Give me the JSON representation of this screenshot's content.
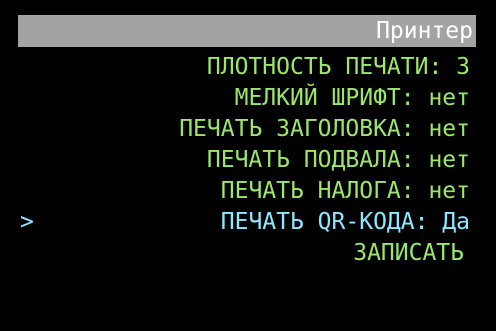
{
  "title": "Принтер",
  "cursor_symbol": ">",
  "colors": {
    "background": "#000000",
    "title_bar": "#a3a3a3",
    "title_text": "#ffffff",
    "item_normal": "#9be76b",
    "item_selected": "#8de8ff"
  },
  "menu": [
    {
      "label": "ПЛОТНОСТЬ ПЕЧАТИ",
      "value": "3",
      "display": "ПЛОТНОСТЬ ПЕЧАТИ: 3",
      "selected": false
    },
    {
      "label": "МЕЛКИЙ ШРИФТ",
      "value": "нет",
      "display": "МЕЛКИЙ ШРИФТ: нет",
      "selected": false
    },
    {
      "label": "ПЕЧАТЬ ЗАГОЛОВКА",
      "value": "нет",
      "display": "ПЕЧАТЬ ЗАГОЛОВКА: нет",
      "selected": false
    },
    {
      "label": "ПЕЧАТЬ ПОДВАЛА",
      "value": "нет",
      "display": "ПЕЧАТЬ ПОДВАЛА: нет",
      "selected": false
    },
    {
      "label": "ПЕЧАТЬ НАЛОГА",
      "value": "нет",
      "display": "ПЕЧАТЬ НАЛОГА: нет",
      "selected": false
    },
    {
      "label": "ПЕЧАТЬ QR-КОДА",
      "value": "Да",
      "display": "ПЕЧАТЬ QR-КОДА: Да",
      "selected": true
    }
  ],
  "save_action": "ЗАПИСАТЬ"
}
